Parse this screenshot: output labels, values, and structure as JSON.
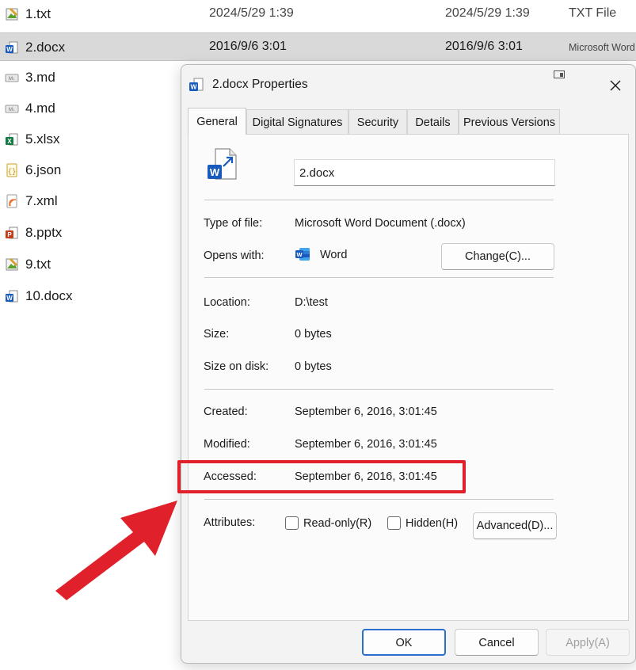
{
  "files": [
    {
      "name": "1.txt",
      "icon": "text-file-icon",
      "created": "2024/5/29 1:39",
      "modified": "2024/5/29 1:39",
      "type": "TXT File"
    },
    {
      "name": "2.docx",
      "icon": "word-file-icon",
      "created": "2016/9/6 3:01",
      "modified": "2016/9/6 3:01",
      "type": "Microsoft Word",
      "selected": true
    },
    {
      "name": "3.md",
      "icon": "markdown-file-icon"
    },
    {
      "name": "4.md",
      "icon": "markdown-file-icon"
    },
    {
      "name": "5.xlsx",
      "icon": "excel-file-icon"
    },
    {
      "name": "6.json",
      "icon": "json-file-icon"
    },
    {
      "name": "7.xml",
      "icon": "xml-file-icon"
    },
    {
      "name": "8.pptx",
      "icon": "powerpoint-file-icon"
    },
    {
      "name": "9.txt",
      "icon": "text-file-icon"
    },
    {
      "name": "10.docx",
      "icon": "word-file-icon"
    }
  ],
  "dialog": {
    "title": "2.docx Properties",
    "tabs": [
      {
        "label": "General",
        "active": true
      },
      {
        "label": "Digital Signatures"
      },
      {
        "label": "Security"
      },
      {
        "label": "Details"
      },
      {
        "label": "Previous Versions"
      }
    ],
    "file_name": "2.docx",
    "type_label": "Type of file:",
    "type_value": "Microsoft Word Document (.docx)",
    "opens_label": "Opens with:",
    "opens_value": "Word",
    "change_button": "Change(C)...",
    "location_label": "Location:",
    "location_value": "D:\\test",
    "size_label": "Size:",
    "size_value": "0 bytes",
    "size_disk_label": "Size on disk:",
    "size_disk_value": "0 bytes",
    "created_label": "Created:",
    "created_value": "September 6, 2016, 3:01:45",
    "modified_label": "Modified:",
    "modified_value": "September 6, 2016, 3:01:45",
    "accessed_label": "Accessed:",
    "accessed_value": "September 6, 2016, 3:01:45",
    "attributes_label": "Attributes:",
    "readonly_label": "Read-only(R)",
    "hidden_label": "Hidden(H)",
    "advanced_button": "Advanced(D)...",
    "ok_button": "OK",
    "cancel_button": "Cancel",
    "apply_button": "Apply(A)"
  },
  "colors": {
    "highlight": "#e0202a",
    "accent_blue": "#2a6fc9",
    "word_blue": "#185abd"
  }
}
